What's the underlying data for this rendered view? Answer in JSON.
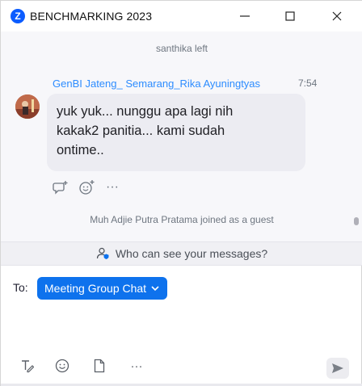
{
  "window": {
    "title": "BENCHMARKING 2023",
    "logo_letter": "Z"
  },
  "chat": {
    "system_left": "santhika left",
    "message": {
      "sender": "GenBI Jateng_ Semarang_Rika Ayuningtyas",
      "time": "7:54",
      "lines": [
        "yuk yuk... nunggu apa lagi nih",
        "kakak2 panitia... kami sudah",
        "ontime.."
      ],
      "more_label": "···"
    },
    "system_joined": "Muh Adjie Putra Pratama joined as a guest"
  },
  "privacy": {
    "text": "Who can see your messages?"
  },
  "compose": {
    "to_label": "To:",
    "recipient": "Meeting Group Chat",
    "more_label": "···"
  },
  "colors": {
    "accent": "#0e72ed",
    "sender": "#2d8cff",
    "logo": "#0b5cff",
    "bubble": "#ececf2"
  }
}
